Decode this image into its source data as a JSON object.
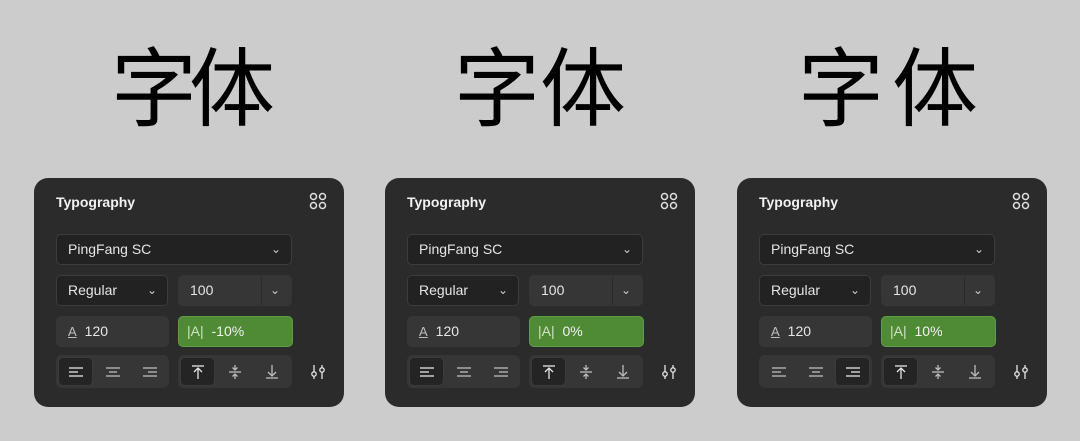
{
  "columns": [
    {
      "sample": "字体",
      "panel": {
        "title": "Typography",
        "font_family": "PingFang SC",
        "weight": "Regular",
        "size": "100",
        "line_height": "120",
        "letter_spacing_icon": "|A|",
        "letter_spacing": "-10%",
        "text_align": "left",
        "vertical_align": "top"
      }
    },
    {
      "sample": "字体",
      "panel": {
        "title": "Typography",
        "font_family": "PingFang SC",
        "weight": "Regular",
        "size": "100",
        "line_height": "120",
        "letter_spacing_icon": "|A|",
        "letter_spacing": "0%",
        "text_align": "left",
        "vertical_align": "top"
      }
    },
    {
      "sample": "字体",
      "panel": {
        "title": "Typography",
        "font_family": "PingFang SC",
        "weight": "Regular",
        "size": "100",
        "line_height": "120",
        "letter_spacing_icon": "|A|",
        "letter_spacing": "10%",
        "text_align": "right",
        "vertical_align": "top"
      }
    }
  ],
  "icons": {
    "chevron": "chevron-down-icon",
    "line_height": "line-height-icon",
    "styles": "styles-grid-icon",
    "tune": "typography-settings-icon"
  },
  "colors": {
    "background": "#cccccc",
    "panel": "#2b2b2b",
    "highlight": "#4f8a35"
  }
}
